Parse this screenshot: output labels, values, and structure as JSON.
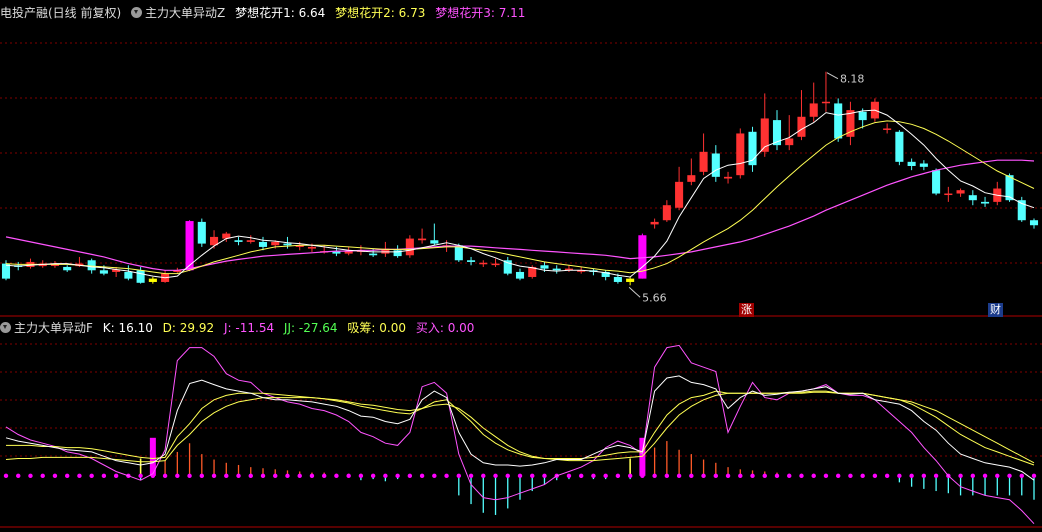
{
  "header": {
    "stock": "电投产融(日线 前复权)",
    "main_indicator": "主力大单异动Z",
    "ma1_label": "梦想花开1:",
    "ma1_value": "6.64",
    "ma2_label": "梦想花开2:",
    "ma2_value": "6.73",
    "ma3_label": "梦想花开3:",
    "ma3_value": "7.11"
  },
  "sub_header": {
    "indicator": "主力大单异动F",
    "k_label": "K:",
    "k_value": "16.10",
    "d_label": "D:",
    "d_value": "29.92",
    "j_label": "J:",
    "j_value": "-11.54",
    "jj_label": "JJ:",
    "jj_value": "-27.64",
    "xc_label": "吸筹:",
    "xc_value": "0.00",
    "buy_label": "买入:",
    "buy_value": "0.00"
  },
  "markers": {
    "zhang": "涨",
    "cai": "财"
  },
  "colors": {
    "up": "#ff3232",
    "down": "#54ffff",
    "ma1": "#ffffff",
    "ma2": "#ffff54",
    "ma3": "#ff54ff",
    "grid": "#800000",
    "special_up": "#ff00ff",
    "special_down": "#ffff00"
  },
  "chart_data": {
    "type": "candlestick",
    "title": "主力大单异动Z",
    "high_label": "8.18",
    "low_label": "5.66",
    "ylim": [
      5.3,
      8.8
    ],
    "candles": [
      [
        5.88,
        5.7,
        5.92,
        5.68
      ],
      [
        5.86,
        5.84,
        5.9,
        5.8
      ],
      [
        5.84,
        5.9,
        5.94,
        5.82
      ],
      [
        5.85,
        5.88,
        5.92,
        5.83
      ],
      [
        5.86,
        5.87,
        5.91,
        5.83
      ],
      [
        5.84,
        5.8,
        5.86,
        5.78
      ],
      [
        5.85,
        5.88,
        5.96,
        5.84
      ],
      [
        5.92,
        5.8,
        5.94,
        5.76
      ],
      [
        5.8,
        5.76,
        5.86,
        5.74
      ],
      [
        5.78,
        5.81,
        5.84,
        5.72
      ],
      [
        5.78,
        5.7,
        5.86,
        5.68
      ],
      [
        5.8,
        5.65,
        5.84,
        5.64
      ],
      [
        5.7,
        5.66,
        5.72,
        5.64
      ],
      [
        5.66,
        5.76,
        5.8,
        5.65
      ],
      [
        5.78,
        5.8,
        5.83,
        5.77
      ],
      [
        5.8,
        6.39,
        6.4,
        5.79
      ],
      [
        6.38,
        6.12,
        6.42,
        6.08
      ],
      [
        6.1,
        6.2,
        6.28,
        6.06
      ],
      [
        6.18,
        6.24,
        6.26,
        6.14
      ],
      [
        6.16,
        6.14,
        6.2,
        6.1
      ],
      [
        6.14,
        6.16,
        6.22,
        6.12
      ],
      [
        6.14,
        6.08,
        6.2,
        6.04
      ],
      [
        6.1,
        6.14,
        6.16,
        6.06
      ],
      [
        6.12,
        6.1,
        6.2,
        6.06
      ],
      [
        6.08,
        6.1,
        6.14,
        6.04
      ],
      [
        6.06,
        6.08,
        6.12,
        6.02
      ],
      [
        6.02,
        6.03,
        6.1,
        6.0
      ],
      [
        6.03,
        6.0,
        6.08,
        5.97
      ],
      [
        6.0,
        6.03,
        6.08,
        5.98
      ],
      [
        6.02,
        6.04,
        6.1,
        5.98
      ],
      [
        6.0,
        5.98,
        6.06,
        5.96
      ],
      [
        6.0,
        6.06,
        6.14,
        5.96
      ],
      [
        6.04,
        5.97,
        6.1,
        5.95
      ],
      [
        5.98,
        6.18,
        6.22,
        5.95
      ],
      [
        6.16,
        6.18,
        6.3,
        6.12
      ],
      [
        6.16,
        6.12,
        6.36,
        6.1
      ],
      [
        6.1,
        6.1,
        6.16,
        6.02
      ],
      [
        6.1,
        5.92,
        6.12,
        5.9
      ],
      [
        5.92,
        5.9,
        5.96,
        5.86
      ],
      [
        5.88,
        5.89,
        5.92,
        5.84
      ],
      [
        5.88,
        5.88,
        5.94,
        5.84
      ],
      [
        5.92,
        5.76,
        5.96,
        5.74
      ],
      [
        5.78,
        5.7,
        5.82,
        5.68
      ],
      [
        5.72,
        5.84,
        5.86,
        5.7
      ],
      [
        5.86,
        5.82,
        5.9,
        5.78
      ],
      [
        5.82,
        5.8,
        5.86,
        5.76
      ],
      [
        5.8,
        5.82,
        5.86,
        5.78
      ],
      [
        5.8,
        5.8,
        5.84,
        5.76
      ],
      [
        5.8,
        5.78,
        5.82,
        5.74
      ],
      [
        5.78,
        5.72,
        5.8,
        5.68
      ],
      [
        5.72,
        5.66,
        5.76,
        5.64
      ],
      [
        5.66,
        5.7,
        5.72,
        5.62
      ],
      [
        5.7,
        6.22,
        6.24,
        5.7
      ],
      [
        6.35,
        6.38,
        6.42,
        6.3
      ],
      [
        6.4,
        6.58,
        6.64,
        6.38
      ],
      [
        6.55,
        6.86,
        7.04,
        6.52
      ],
      [
        6.86,
        6.94,
        7.14,
        6.82
      ],
      [
        6.98,
        7.22,
        7.44,
        6.94
      ],
      [
        7.2,
        6.92,
        7.3,
        6.86
      ],
      [
        6.9,
        6.92,
        6.98,
        6.84
      ],
      [
        6.94,
        7.44,
        7.5,
        6.9
      ],
      [
        7.46,
        7.06,
        7.52,
        6.98
      ],
      [
        7.22,
        7.62,
        7.92,
        7.16
      ],
      [
        7.6,
        7.3,
        7.72,
        7.24
      ],
      [
        7.3,
        7.38,
        7.66,
        7.24
      ],
      [
        7.4,
        7.64,
        7.96,
        7.36
      ],
      [
        7.64,
        7.8,
        8.05,
        7.58
      ],
      [
        7.82,
        7.82,
        8.18,
        7.7
      ],
      [
        7.8,
        7.38,
        7.86,
        7.34
      ],
      [
        7.4,
        7.72,
        7.82,
        7.3
      ],
      [
        7.7,
        7.6,
        7.74,
        7.5
      ],
      [
        7.62,
        7.82,
        7.86,
        7.58
      ],
      [
        7.5,
        7.5,
        7.56,
        7.44
      ],
      [
        7.46,
        7.1,
        7.48,
        7.06
      ],
      [
        7.1,
        7.05,
        7.14,
        7.0
      ],
      [
        7.08,
        7.04,
        7.12,
        7.0
      ],
      [
        7.0,
        6.72,
        7.02,
        6.7
      ],
      [
        6.72,
        6.72,
        6.8,
        6.62
      ],
      [
        6.72,
        6.76,
        6.78,
        6.68
      ],
      [
        6.7,
        6.64,
        6.76,
        6.58
      ],
      [
        6.62,
        6.6,
        6.68,
        6.56
      ],
      [
        6.62,
        6.78,
        6.86,
        6.58
      ],
      [
        6.94,
        6.64,
        6.96,
        6.62
      ],
      [
        6.64,
        6.4,
        6.68,
        6.38
      ],
      [
        6.4,
        6.34,
        6.42,
        6.3
      ]
    ],
    "ma1": [
      5.86,
      5.85,
      5.86,
      5.87,
      5.88,
      5.88,
      5.86,
      5.84,
      5.83,
      5.81,
      5.79,
      5.76,
      5.73,
      5.71,
      5.73,
      5.86,
      5.98,
      6.09,
      6.18,
      6.21,
      6.19,
      6.16,
      6.15,
      6.13,
      6.12,
      6.1,
      6.08,
      6.06,
      6.04,
      6.03,
      6.02,
      6.02,
      6.02,
      6.04,
      6.07,
      6.1,
      6.13,
      6.1,
      6.06,
      6.0,
      5.95,
      5.89,
      5.85,
      5.83,
      5.8,
      5.79,
      5.8,
      5.8,
      5.79,
      5.77,
      5.74,
      5.72,
      5.84,
      5.97,
      6.15,
      6.44,
      6.67,
      6.9,
      7.0,
      7.06,
      7.08,
      7.12,
      7.28,
      7.34,
      7.39,
      7.49,
      7.57,
      7.69,
      7.66,
      7.68,
      7.71,
      7.72,
      7.66,
      7.55,
      7.43,
      7.3,
      7.14,
      7.0,
      6.87,
      6.81,
      6.73,
      6.7,
      6.68,
      6.6,
      6.55
    ],
    "ma2": [
      5.88,
      5.87,
      5.87,
      5.87,
      5.87,
      5.87,
      5.86,
      5.85,
      5.84,
      5.83,
      5.82,
      5.8,
      5.78,
      5.76,
      5.76,
      5.8,
      5.85,
      5.9,
      5.94,
      5.98,
      6.02,
      6.05,
      6.08,
      6.09,
      6.1,
      6.1,
      6.1,
      6.09,
      6.08,
      6.07,
      6.06,
      6.05,
      6.05,
      6.05,
      6.06,
      6.07,
      6.08,
      6.08,
      6.06,
      6.04,
      6.02,
      5.99,
      5.96,
      5.93,
      5.9,
      5.88,
      5.86,
      5.84,
      5.82,
      5.8,
      5.79,
      5.77,
      5.79,
      5.83,
      5.88,
      5.96,
      6.05,
      6.14,
      6.22,
      6.3,
      6.4,
      6.52,
      6.66,
      6.8,
      6.93,
      7.06,
      7.18,
      7.3,
      7.39,
      7.46,
      7.52,
      7.57,
      7.59,
      7.58,
      7.55,
      7.5,
      7.43,
      7.35,
      7.26,
      7.17,
      7.08,
      6.99,
      6.92,
      6.85,
      6.78
    ],
    "ma3": [
      6.2,
      6.17,
      6.14,
      6.11,
      6.08,
      6.05,
      6.02,
      5.99,
      5.96,
      5.92,
      5.88,
      5.85,
      5.82,
      5.8,
      5.8,
      5.82,
      5.85,
      5.88,
      5.91,
      5.93,
      5.95,
      5.97,
      5.98,
      5.99,
      6.0,
      6.01,
      6.02,
      6.03,
      6.03,
      6.04,
      6.04,
      6.05,
      6.05,
      6.06,
      6.07,
      6.08,
      6.09,
      6.09,
      6.09,
      6.08,
      6.07,
      6.06,
      6.05,
      6.04,
      6.03,
      6.02,
      6.01,
      6.0,
      5.99,
      5.98,
      5.96,
      5.94,
      5.95,
      5.96,
      5.98,
      6.0,
      6.02,
      6.05,
      6.08,
      6.11,
      6.14,
      6.18,
      6.23,
      6.28,
      6.33,
      6.39,
      6.45,
      6.52,
      6.58,
      6.64,
      6.7,
      6.76,
      6.82,
      6.87,
      6.92,
      6.96,
      7.0,
      7.03,
      7.06,
      7.08,
      7.1,
      7.12,
      7.12,
      7.12,
      7.11
    ],
    "sub": {
      "title": "主力大单异动F",
      "ylim": [
        -48,
        125
      ],
      "k": [
        35,
        32,
        30,
        28,
        26,
        24,
        23,
        22,
        18,
        14,
        12,
        10,
        12,
        20,
        60,
        85,
        88,
        84,
        80,
        78,
        76,
        72,
        70,
        70,
        69,
        68,
        66,
        64,
        60,
        55,
        54,
        50,
        48,
        52,
        70,
        78,
        72,
        40,
        20,
        12,
        10,
        10,
        9,
        10,
        12,
        15,
        15,
        15,
        20,
        25,
        28,
        26,
        22,
        78,
        90,
        92,
        86,
        84,
        80,
        62,
        72,
        78,
        74,
        75,
        77,
        78,
        80,
        82,
        76,
        75,
        76,
        70,
        68,
        66,
        60,
        50,
        42,
        30,
        20,
        16,
        12,
        10,
        8,
        4,
        -4
      ],
      "d": [
        28,
        28,
        28,
        27,
        27,
        26,
        26,
        25,
        23,
        21,
        19,
        17,
        16,
        17,
        36,
        48,
        62,
        70,
        74,
        76,
        76,
        76,
        75,
        74,
        73,
        72,
        71,
        69,
        67,
        64,
        62,
        60,
        58,
        57,
        62,
        68,
        70,
        60,
        50,
        38,
        30,
        24,
        20,
        17,
        16,
        16,
        16,
        16,
        17,
        19,
        21,
        22,
        22,
        40,
        56,
        66,
        72,
        74,
        78,
        76,
        76,
        76,
        76,
        76,
        77,
        77,
        78,
        78,
        76,
        76,
        76,
        74,
        72,
        70,
        66,
        60,
        54,
        46,
        38,
        32,
        26,
        22,
        18,
        14,
        10
      ],
      "j": [
        45,
        38,
        33,
        30,
        27,
        22,
        20,
        16,
        10,
        4,
        0,
        -4,
        2,
        24,
        106,
        118,
        118,
        110,
        94,
        88,
        86,
        76,
        72,
        68,
        66,
        62,
        60,
        56,
        50,
        40,
        36,
        30,
        28,
        40,
        82,
        86,
        76,
        20,
        -8,
        -20,
        -22,
        -20,
        -16,
        -12,
        -8,
        0,
        4,
        8,
        14,
        26,
        32,
        28,
        20,
        100,
        118,
        120,
        104,
        100,
        96,
        40,
        64,
        86,
        72,
        70,
        76,
        78,
        80,
        84,
        76,
        74,
        74,
        70,
        60,
        50,
        40,
        26,
        14,
        0,
        -10,
        -14,
        -18,
        -20,
        -22,
        -32,
        -44
      ],
      "jj": [
        15,
        16,
        16,
        17,
        17,
        17,
        17,
        17,
        16,
        15,
        14,
        13,
        13,
        14,
        28,
        38,
        50,
        58,
        64,
        68,
        70,
        72,
        72,
        72,
        72,
        72,
        71,
        70,
        68,
        66,
        65,
        63,
        61,
        60,
        62,
        65,
        66,
        62,
        54,
        44,
        36,
        28,
        22,
        18,
        16,
        15,
        14,
        14,
        14,
        15,
        16,
        17,
        18,
        30,
        44,
        56,
        64,
        70,
        74,
        76,
        76,
        76,
        76,
        76,
        76,
        76,
        77,
        77,
        76,
        76,
        76,
        74,
        72,
        70,
        68,
        64,
        60,
        54,
        48,
        42,
        36,
        30,
        24,
        18,
        12
      ],
      "xc": [
        0,
        0,
        0,
        0,
        0,
        0,
        0,
        0,
        0,
        0,
        0,
        16,
        0,
        0,
        0,
        0,
        0,
        0,
        0,
        0,
        0,
        0,
        0,
        0,
        0,
        0,
        0,
        0,
        0,
        0,
        0,
        0,
        0,
        0,
        0,
        0,
        0,
        0,
        0,
        0,
        0,
        0,
        0,
        0,
        0,
        0,
        0,
        0,
        0,
        0,
        0,
        16,
        0,
        0,
        0,
        0,
        0,
        0,
        0,
        0,
        0,
        0,
        0,
        0,
        0,
        0,
        0,
        0,
        0,
        0,
        0,
        0,
        0,
        0,
        0,
        0,
        0,
        0,
        0,
        0,
        0,
        0,
        0,
        0,
        0
      ],
      "buy": [
        0,
        0,
        0,
        0,
        0,
        0,
        0,
        0,
        0,
        0,
        0,
        0,
        35,
        0,
        0,
        0,
        0,
        0,
        0,
        0,
        0,
        0,
        0,
        0,
        0,
        0,
        0,
        0,
        0,
        0,
        0,
        0,
        0,
        0,
        0,
        0,
        0,
        0,
        0,
        0,
        0,
        0,
        0,
        0,
        0,
        0,
        0,
        0,
        0,
        0,
        0,
        0,
        35,
        0,
        0,
        0,
        0,
        0,
        0,
        0,
        0,
        0,
        0,
        0,
        0,
        0,
        0,
        0,
        0,
        0,
        0,
        0,
        0,
        0,
        0,
        0,
        0,
        0,
        0,
        0,
        0,
        0,
        0,
        0,
        0
      ],
      "vol_up": [
        0,
        0,
        0,
        0,
        0,
        0,
        0,
        0,
        0,
        0,
        0,
        0,
        0,
        14,
        22,
        30,
        20,
        15,
        12,
        10,
        8,
        7,
        6,
        5,
        4,
        3,
        3,
        2,
        2,
        2,
        0,
        0,
        0,
        0,
        0,
        0,
        0,
        0,
        0,
        0,
        0,
        0,
        0,
        0,
        0,
        0,
        0,
        0,
        0,
        0,
        0,
        0,
        0,
        26,
        32,
        24,
        20,
        15,
        12,
        8,
        6,
        5,
        4,
        3,
        2,
        2,
        2,
        1,
        0,
        0,
        0,
        0,
        0,
        0,
        0,
        0,
        0,
        0,
        0,
        0,
        0,
        0,
        0,
        0,
        0
      ],
      "vol_down": [
        0,
        0,
        0,
        0,
        0,
        0,
        0,
        0,
        0,
        0,
        0,
        -4,
        0,
        0,
        0,
        0,
        0,
        0,
        0,
        0,
        0,
        0,
        0,
        0,
        0,
        0,
        0,
        0,
        0,
        -4,
        -3,
        -5,
        -3,
        0,
        0,
        0,
        0,
        -18,
        -26,
        -34,
        -36,
        -30,
        -22,
        -14,
        -8,
        -4,
        -3,
        -2,
        -3,
        -3,
        -2,
        -3,
        0,
        0,
        0,
        0,
        0,
        0,
        0,
        0,
        0,
        0,
        0,
        0,
        0,
        0,
        0,
        0,
        0,
        0,
        0,
        0,
        0,
        -6,
        -10,
        -12,
        -14,
        -16,
        -18,
        -18,
        -18,
        -18,
        -18,
        -18,
        -22
      ]
    }
  }
}
